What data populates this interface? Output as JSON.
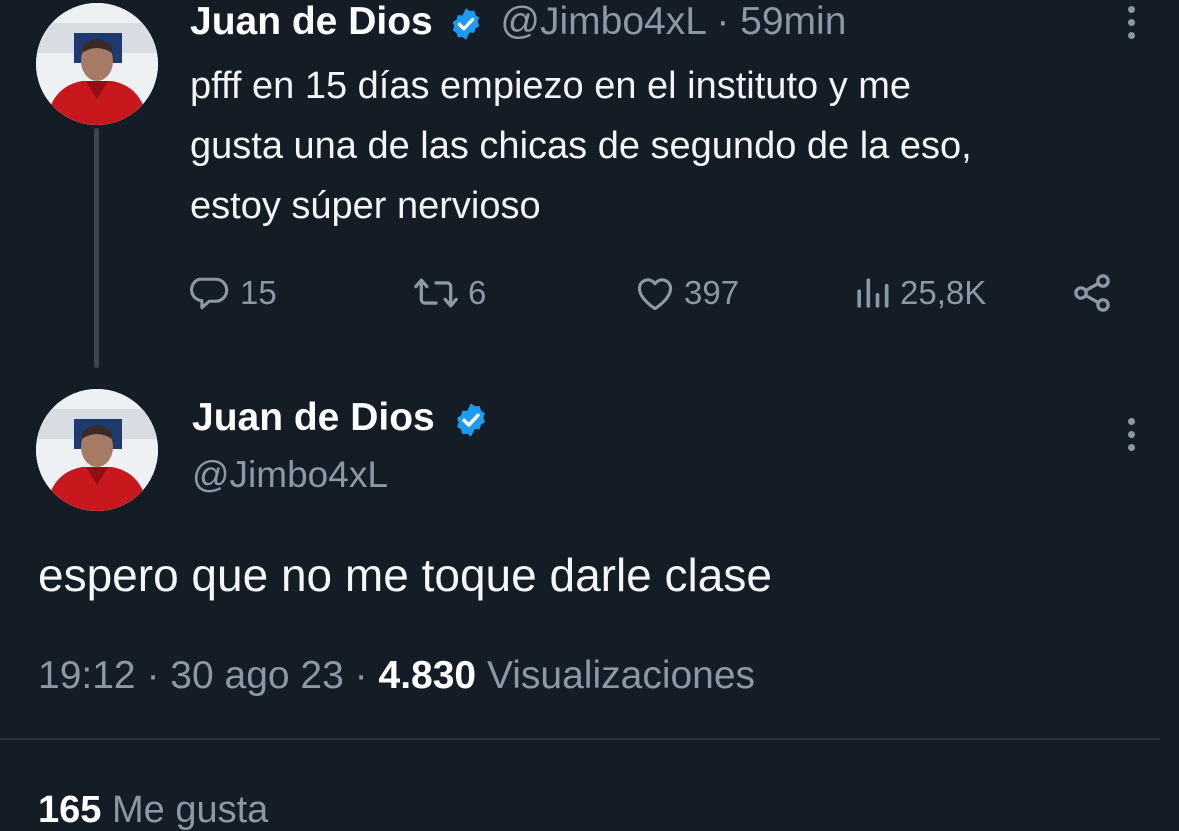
{
  "tweet1": {
    "author_name": "Juan de Dios",
    "handle": "@Jimbo4xL",
    "separator": "·",
    "time_ago": "59min",
    "text_line1": "pfff en 15 días empiezo en el instituto y me",
    "text_line2": "gusta una de las chicas de segundo de la eso,",
    "text_line3": "estoy súper nervioso",
    "actions": {
      "replies": "15",
      "retweets": "6",
      "likes": "397",
      "views": "25,8K"
    }
  },
  "tweet2": {
    "author_name": "Juan de Dios",
    "handle": "@Jimbo4xL",
    "text": "espero que no me toque darle clase",
    "meta": {
      "time": "19:12",
      "sep1": "·",
      "date": "30 ago 23",
      "sep2": "·",
      "views_count": "4.830",
      "views_label": "Visualizaciones"
    },
    "likes_count": "165",
    "likes_label": "Me gusta"
  },
  "colors": {
    "background": "#141c26",
    "text": "#ffffff",
    "muted": "#8b98a5",
    "verified_blue": "#1d9bf0"
  },
  "icons": {
    "reply": "reply-icon",
    "retweet": "retweet-icon",
    "like": "heart-icon",
    "views": "views-icon",
    "share": "share-icon",
    "more": "more-vertical-icon",
    "verified": "verified-badge-icon"
  }
}
